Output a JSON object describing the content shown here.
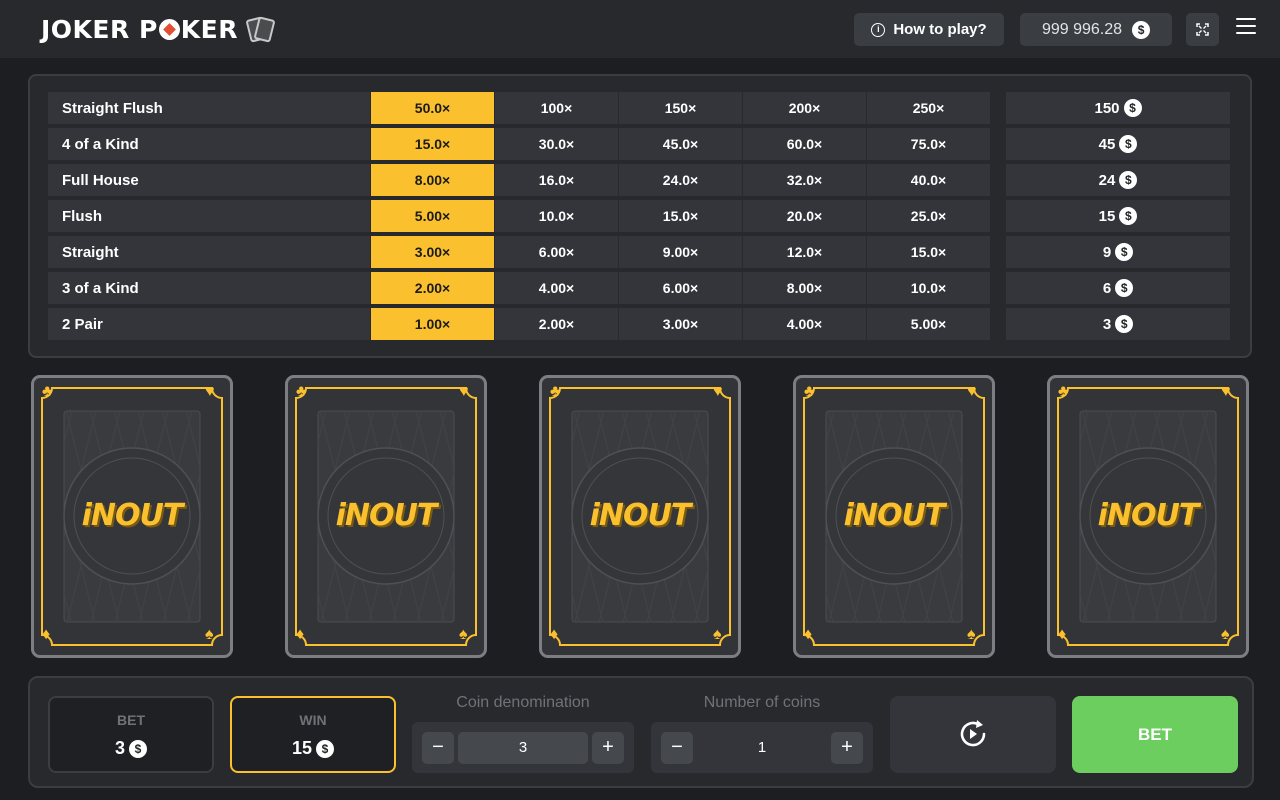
{
  "header": {
    "logo_left": "JOKER P",
    "logo_right": "KER",
    "how_to_play": "How to play?",
    "balance": "999 996.28",
    "currency_icon": "$"
  },
  "paytable": {
    "active_column": 0,
    "rows": [
      {
        "hand": "Straight Flush",
        "multipliers": [
          "50.0×",
          "100×",
          "150×",
          "200×",
          "250×"
        ],
        "win": "150"
      },
      {
        "hand": "4 of a Kind",
        "multipliers": [
          "15.0×",
          "30.0×",
          "45.0×",
          "60.0×",
          "75.0×"
        ],
        "win": "45"
      },
      {
        "hand": "Full House",
        "multipliers": [
          "8.00×",
          "16.0×",
          "24.0×",
          "32.0×",
          "40.0×"
        ],
        "win": "24"
      },
      {
        "hand": "Flush",
        "multipliers": [
          "5.00×",
          "10.0×",
          "15.0×",
          "20.0×",
          "25.0×"
        ],
        "win": "15"
      },
      {
        "hand": "Straight",
        "multipliers": [
          "3.00×",
          "6.00×",
          "9.00×",
          "12.0×",
          "15.0×"
        ],
        "win": "9"
      },
      {
        "hand": "3 of a Kind",
        "multipliers": [
          "2.00×",
          "4.00×",
          "6.00×",
          "8.00×",
          "10.0×"
        ],
        "win": "6"
      },
      {
        "hand": "2 Pair",
        "multipliers": [
          "1.00×",
          "2.00×",
          "3.00×",
          "4.00×",
          "5.00×"
        ],
        "win": "3"
      }
    ]
  },
  "cards": [
    {
      "brand": "iNOUT",
      "suits": [
        "club",
        "heart",
        "diamond",
        "spade"
      ]
    },
    {
      "brand": "iNOUT",
      "suits": [
        "club",
        "heart",
        "diamond",
        "spade"
      ]
    },
    {
      "brand": "iNOUT",
      "suits": [
        "club",
        "heart",
        "diamond",
        "spade"
      ]
    },
    {
      "brand": "iNOUT",
      "suits": [
        "club",
        "heart",
        "diamond",
        "spade"
      ]
    },
    {
      "brand": "iNOUT",
      "suits": [
        "club",
        "heart",
        "diamond",
        "spade"
      ]
    }
  ],
  "controls": {
    "bet_label": "BET",
    "bet_value": "3",
    "win_label": "WIN",
    "win_value": "15",
    "coin_denomination_label": "Coin denomination",
    "coin_denomination_value": "3",
    "number_of_coins_label": "Number of coins",
    "number_of_coins_value": "1",
    "minus": "−",
    "plus": "+",
    "bet_button": "BET"
  },
  "colors": {
    "accent_yellow": "#fbc02d",
    "bet_green": "#6cce5f",
    "background": "#1c1e21",
    "panel": "#27292d",
    "cell": "#33353a",
    "logo_red": "#e24f33"
  },
  "icons": {
    "how_to_play": "info-icon",
    "fullscreen": "fullscreen-icon",
    "menu": "hamburger-menu-icon",
    "replay": "replay-icon",
    "currency": "dollar-coin-icon"
  }
}
